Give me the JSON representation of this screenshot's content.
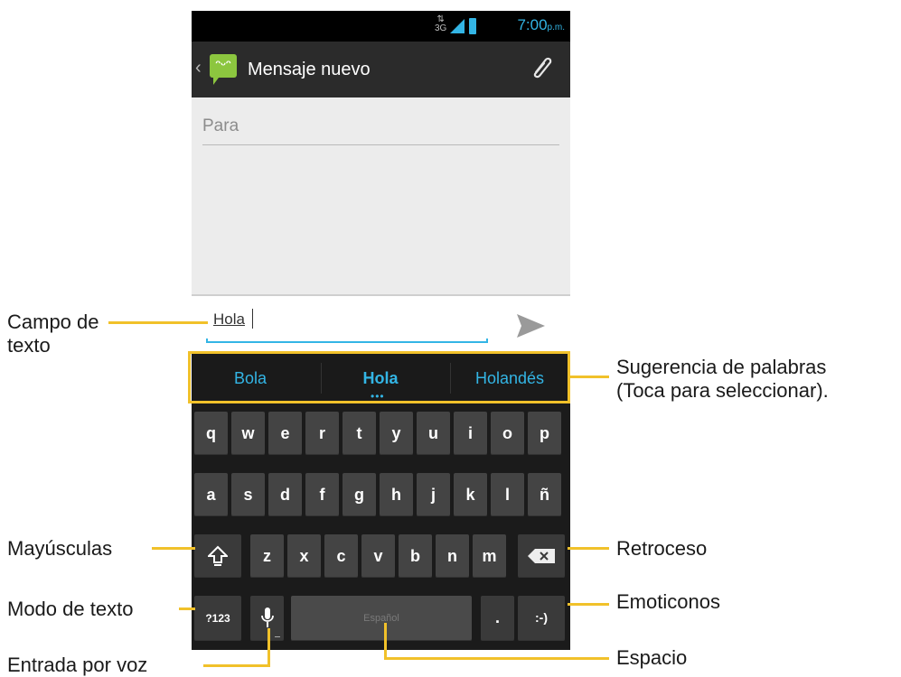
{
  "status_bar": {
    "network": "3G",
    "time": "7:00",
    "ampm": "p.m."
  },
  "action_bar": {
    "title": "Mensaje nuevo",
    "app_icon": "messaging-icon",
    "attach_icon": "paperclip-icon"
  },
  "compose": {
    "to_placeholder": "Para",
    "message_text": "Hola",
    "send_icon": "send-icon"
  },
  "suggestions": [
    "Bola",
    "Hola",
    "Holandés"
  ],
  "keyboard": {
    "row1": [
      "q",
      "w",
      "e",
      "r",
      "t",
      "y",
      "u",
      "i",
      "o",
      "p"
    ],
    "row2": [
      "a",
      "s",
      "d",
      "f",
      "g",
      "h",
      "j",
      "k",
      "l",
      "ñ"
    ],
    "row3": [
      "z",
      "x",
      "c",
      "v",
      "b",
      "n",
      "m"
    ],
    "mode_key": "?123",
    "space_label": "Español",
    "period_key": ".",
    "emoticon_key": ":-)",
    "shift_icon": "shift-arrow-icon",
    "backspace_icon": "backspace-icon",
    "mic_icon": "microphone-icon"
  },
  "annotations": {
    "campo_texto": "Campo de\ntexto",
    "sugerencias_1": "Sugerencia de palabras",
    "sugerencias_2": "(Toca para seleccionar).",
    "mayusculas": "Mayúsculas",
    "retroceso": "Retroceso",
    "modo_texto": "Modo de texto",
    "emoticonos": "Emoticonos",
    "entrada_voz": "Entrada por voz",
    "espacio": "Espacio"
  },
  "colors": {
    "accent": "#33b5e5",
    "callout": "#f1c12a",
    "app_icon_green": "#8cc63f"
  }
}
